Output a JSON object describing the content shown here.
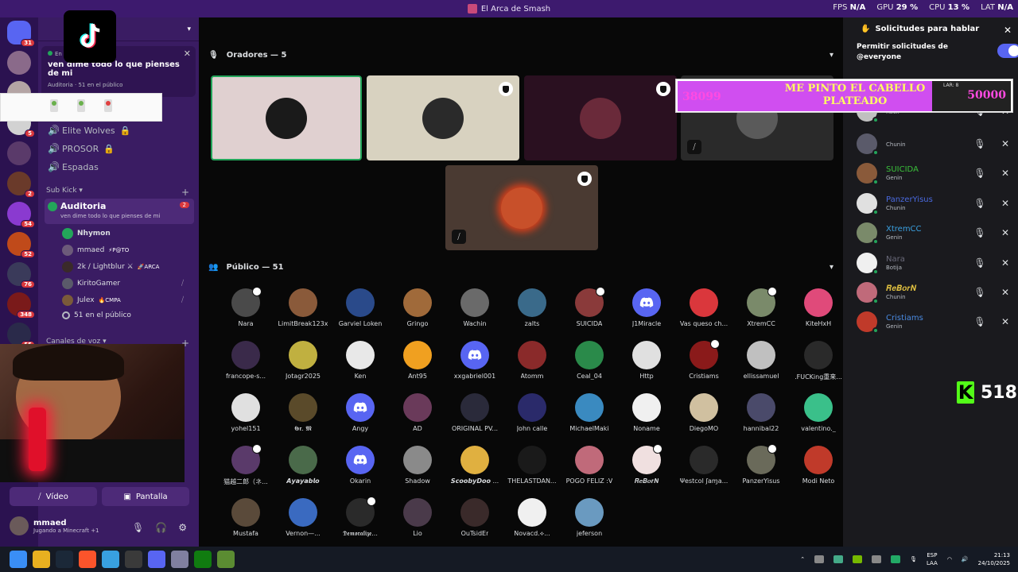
{
  "window": {
    "title": "El Arca de Smash"
  },
  "stats": [
    {
      "label": "FPS",
      "value": "N/A"
    },
    {
      "label": "GPU",
      "value": "29 %"
    },
    {
      "label": "CPU",
      "value": "13 %"
    },
    {
      "label": "LAT",
      "value": "N/A"
    }
  ],
  "servers": [
    {
      "badge": "31"
    },
    {
      "badge": ""
    },
    {
      "badge": "2"
    },
    {
      "badge": "5"
    },
    {
      "badge": ""
    },
    {
      "badge": "2"
    },
    {
      "badge": "54"
    },
    {
      "badge": "52"
    },
    {
      "badge": "76"
    },
    {
      "badge": "348"
    },
    {
      "badge": "55"
    }
  ],
  "server_label": "LB",
  "guild": {
    "name": "sh"
  },
  "stage_card": {
    "live": "En D",
    "topic": "ven dime todo lo que pienses de mi",
    "channel": "Auditoria",
    "audience": "51 en el público",
    "speakers": "Nhymon y 4 personas más"
  },
  "channels": [
    {
      "name": "Elite Wolves"
    },
    {
      "name": "PROSOR"
    },
    {
      "name": "Espadas"
    }
  ],
  "categories": {
    "subkick": "Sub Kick",
    "voice": "Canales de voz"
  },
  "active_channel": {
    "name": "Auditoria",
    "sub": "ven dime todo lo que pienses de mi",
    "count": "2"
  },
  "members": [
    {
      "name": "Nhymon",
      "tag": ""
    },
    {
      "name": "mmaed",
      "tag": "⚡P@TO"
    },
    {
      "name": "2k / Lightblur ⚔",
      "tag": "🚀ARCA"
    },
    {
      "name": "KiritoGamer",
      "tag": ""
    },
    {
      "name": "Julex",
      "tag": "🔥CMPA"
    },
    {
      "name": "51 en el público",
      "tag": ""
    }
  ],
  "bottom_buttons": {
    "video": "Vídeo",
    "screen": "Pantalla"
  },
  "user": {
    "name": "mmaed",
    "status": "Jugando a Minecraft +1"
  },
  "sections": {
    "speakers": "Oradores — 5",
    "audience": "Público — 51"
  },
  "audience": [
    "Nara",
    "LimitBreak123x",
    "Garviel Loken",
    "Gringo",
    "Wachin",
    "zalts",
    "SUICIDA",
    "J1Miracle",
    "Vas queso ch...",
    "XtremCC",
    "KiteHxH",
    "francope-s...",
    "Jotagr2025",
    "Ken",
    "Ant95",
    "xxgabriel001",
    "Atomm",
    "Ceal_04",
    "Http",
    "Cristiams",
    "ellissamuel",
    ".FUCKing重来...",
    "yohel151",
    "𝕲𝖗. 𝕸",
    "Angy",
    "AD",
    "ORIGINAL PV...",
    "John calle",
    "MichaelMaki",
    "Noname",
    "DiegoMO",
    "hannibal22",
    "valentino._",
    "猫越二郎（ネ...",
    "𝘼𝙮𝙖𝙮𝙖𝙗𝙡𝙤",
    "Okarin",
    "Shadow",
    "𝙎𝙘𝙤𝙤𝙗𝙮𝘿𝙤𝙤 ...",
    "THELASTDAN...",
    "POGO FELIZ :V",
    "𝑹𝒆𝑩𝒐𝒓𝑵",
    "Ψestcol ʃaɱa...",
    "PanzerYisus",
    "Modi Neto",
    "Mustafa",
    "Vernon—...",
    "𝕯𝖊𝖒𝖔𝖗𝖆𝖑𝖎𝖟𝖊...",
    "Lio",
    "OuTsidEr",
    "Novacd.⟡...",
    "jeferson"
  ],
  "right_panel": {
    "title": "Solicitudes para hablar",
    "permission": "Permitir solicitudes de @everyone"
  },
  "requests": [
    {
      "name": "",
      "rank": "Recl."
    },
    {
      "name": "",
      "rank": "Chunin"
    },
    {
      "name": "SUICIDA",
      "rank": "Genin"
    },
    {
      "name": "PanzerYisus",
      "rank": "Chunin"
    },
    {
      "name": "XtremCC",
      "rank": "Genin"
    },
    {
      "name": "Nara",
      "rank": "Botija"
    },
    {
      "name": "𝑹𝒆𝑩𝒐𝒓𝑵",
      "rank": "Chunin"
    },
    {
      "name": "Cristiams",
      "rank": "Genin"
    }
  ],
  "banner": {
    "left": "38099",
    "title": "ME PINTO EL CABELLO PLATEADO",
    "right": "50000",
    "lar": "LAR: 8"
  },
  "kick_counter": {
    "value": "518"
  },
  "tray": {
    "lang": "ESP",
    "layout": "LAA",
    "time": "21:13",
    "date": "24/10/2025"
  }
}
